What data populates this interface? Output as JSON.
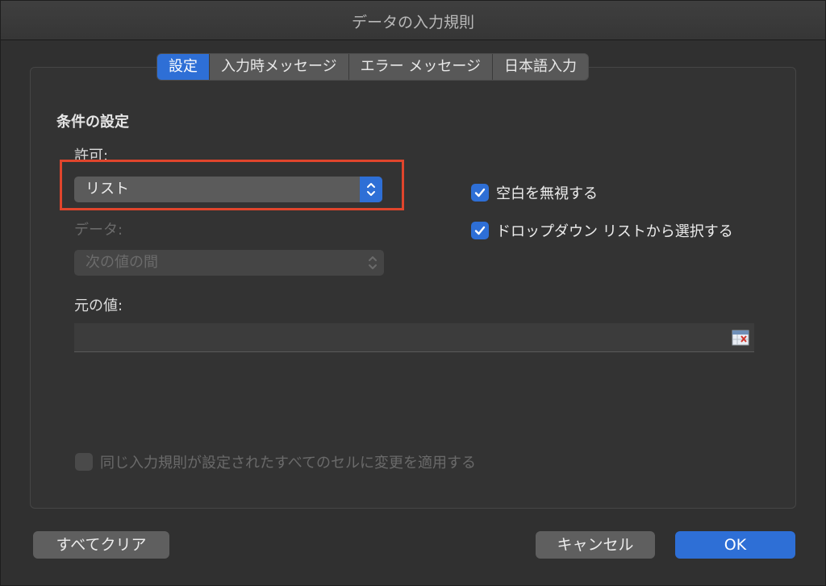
{
  "window": {
    "title": "データの入力規則"
  },
  "tabs": [
    {
      "label": "設定",
      "active": true
    },
    {
      "label": "入力時メッセージ",
      "active": false
    },
    {
      "label": "エラー メッセージ",
      "active": false
    },
    {
      "label": "日本語入力",
      "active": false
    }
  ],
  "criteria": {
    "heading": "条件の設定",
    "allow_label": "許可:",
    "allow_value": "リスト",
    "data_label": "データ:",
    "data_value": "次の値の間",
    "source_label": "元の値:",
    "source_value": ""
  },
  "checkboxes": {
    "ignore_blank": {
      "label": "空白を無視する",
      "checked": true
    },
    "dropdown": {
      "label": "ドロップダウン リストから選択する",
      "checked": true
    },
    "apply_all": {
      "label": "同じ入力規則が設定されたすべてのセルに変更を適用する",
      "checked": false,
      "disabled": true
    }
  },
  "buttons": {
    "clear_all": "すべてクリア",
    "cancel": "キャンセル",
    "ok": "OK"
  },
  "colors": {
    "accent": "#2e6fd6",
    "highlight_border": "#e0452c"
  }
}
